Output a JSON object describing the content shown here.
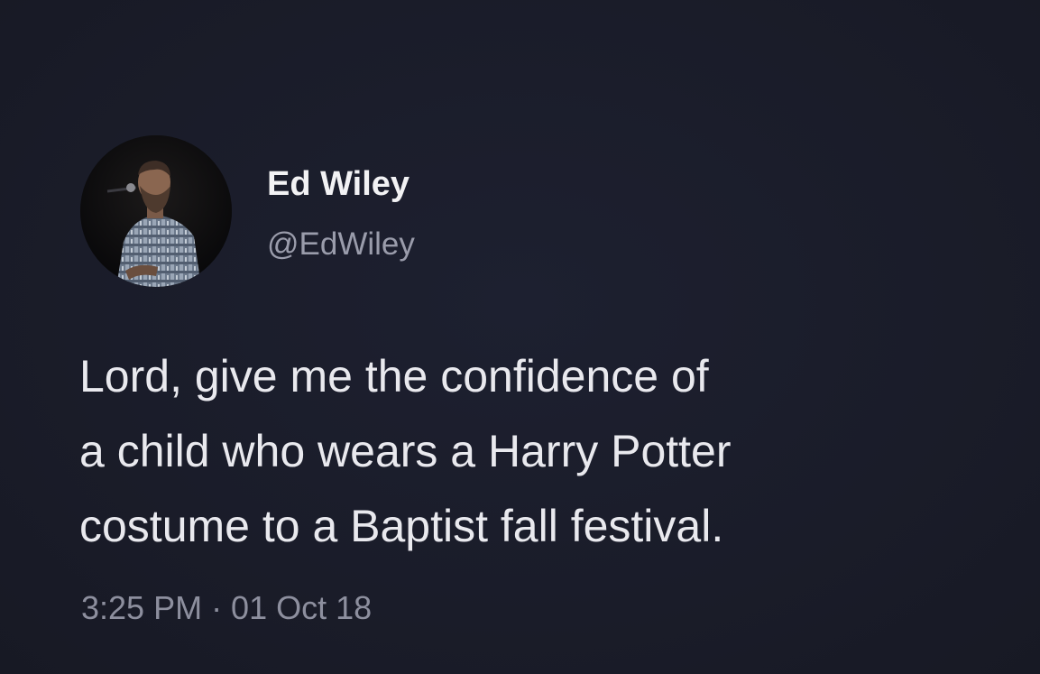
{
  "tweet": {
    "author": {
      "display_name": "Ed Wiley",
      "handle": "@EdWiley",
      "avatar_icon": "profile-photo-man-with-beard"
    },
    "text_lines": [
      "Lord, give me the confidence of",
      "a child who wears a Harry Potter",
      "costume to a Baptist fall festival."
    ],
    "timestamp": "3:25 PM · 01 Oct 18"
  },
  "colors": {
    "background": "#1a1d2b",
    "name_text": "#f2f2f4",
    "handle_text": "#9a9cab",
    "body_text": "#e9e9ee",
    "meta_text": "#8d8f9e"
  }
}
